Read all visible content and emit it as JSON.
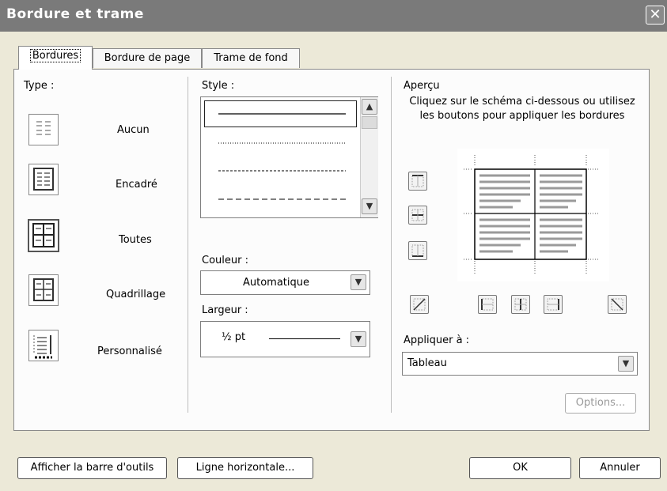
{
  "window": {
    "title": "Bordure et trame",
    "close_glyph": "✕"
  },
  "tabs": [
    {
      "label": "Bordures",
      "active": true
    },
    {
      "label": "Bordure de page",
      "active": false
    },
    {
      "label": "Trame de fond",
      "active": false
    }
  ],
  "type_section": {
    "label": "Type :",
    "items": [
      {
        "label": "Aucun",
        "icon": "none-border-icon",
        "selected": false
      },
      {
        "label": "Encadré",
        "icon": "box-border-icon",
        "selected": false
      },
      {
        "label": "Toutes",
        "icon": "all-borders-icon",
        "selected": true
      },
      {
        "label": "Quadrillage",
        "icon": "grid-border-icon",
        "selected": false
      },
      {
        "label": "Personnalisé",
        "icon": "custom-border-icon",
        "selected": false
      }
    ]
  },
  "style_section": {
    "label": "Style :",
    "styles": [
      "solid",
      "dotted",
      "dashed-small",
      "dashed-large"
    ],
    "selected_index": 0
  },
  "color": {
    "label": "Couleur :",
    "value": "Automatique"
  },
  "width": {
    "label": "Largeur :",
    "value": "½ pt"
  },
  "preview": {
    "label": "Aperçu",
    "instructions_line1": "Cliquez sur le schéma ci-dessous ou utilisez",
    "instructions_line2": "les boutons pour appliquer les bordures"
  },
  "apply_to": {
    "label": "Appliquer à :",
    "value": "Tableau"
  },
  "options_button": {
    "label": "Options...",
    "enabled": false
  },
  "footer": {
    "toolbar_button": "Afficher la barre d'outils",
    "horizontal_line_button": "Ligne horizontale...",
    "ok_button": "OK",
    "cancel_button": "Annuler"
  },
  "colors": {
    "titlebar": "#7a7a7a",
    "dialog_bg": "#ece9d8",
    "panel_bg": "#fcfcfc"
  }
}
